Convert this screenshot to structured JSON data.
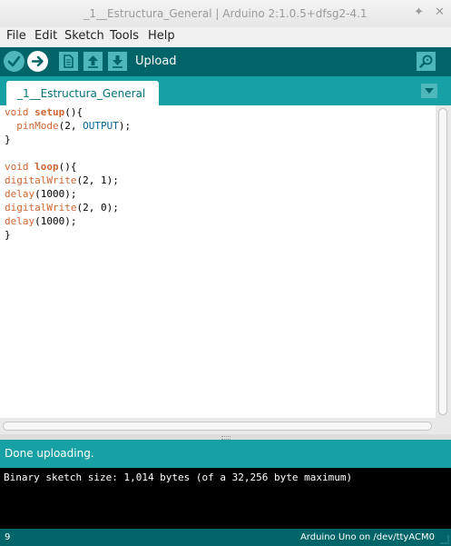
{
  "window": {
    "title": "_1__Estructura_General | Arduino 2:1.0.5+dfsg2-4.1"
  },
  "menu": [
    "File",
    "Edit",
    "Sketch",
    "Tools",
    "Help"
  ],
  "toolbar": {
    "hint": "Upload",
    "icons": [
      "verify-icon",
      "upload-icon",
      "new-icon",
      "open-icon",
      "save-icon",
      "serial-monitor-icon"
    ]
  },
  "tabs": [
    {
      "label": "_1__Estructura_General"
    }
  ],
  "editor": {
    "lines": [
      "void setup(){",
      "  pinMode(2, OUTPUT);",
      "}",
      "",
      "void loop(){",
      "digitalWrite(2, 1);",
      "delay(1000);",
      "digitalWrite(2, 0);",
      "delay(1000);",
      "}"
    ]
  },
  "status": {
    "message": "Done uploading."
  },
  "console": {
    "text": "Binary sketch size: 1,014 bytes (of a 32,256 byte maximum)"
  },
  "footer": {
    "line_number": "9",
    "board": "Arduino Uno on /dev/ttyACM0"
  },
  "colors": {
    "toolbar": "#006468",
    "tabbar": "#17a1a5",
    "button": "#4db7bb",
    "keyword": "#cc6633",
    "constant": "#006699"
  }
}
